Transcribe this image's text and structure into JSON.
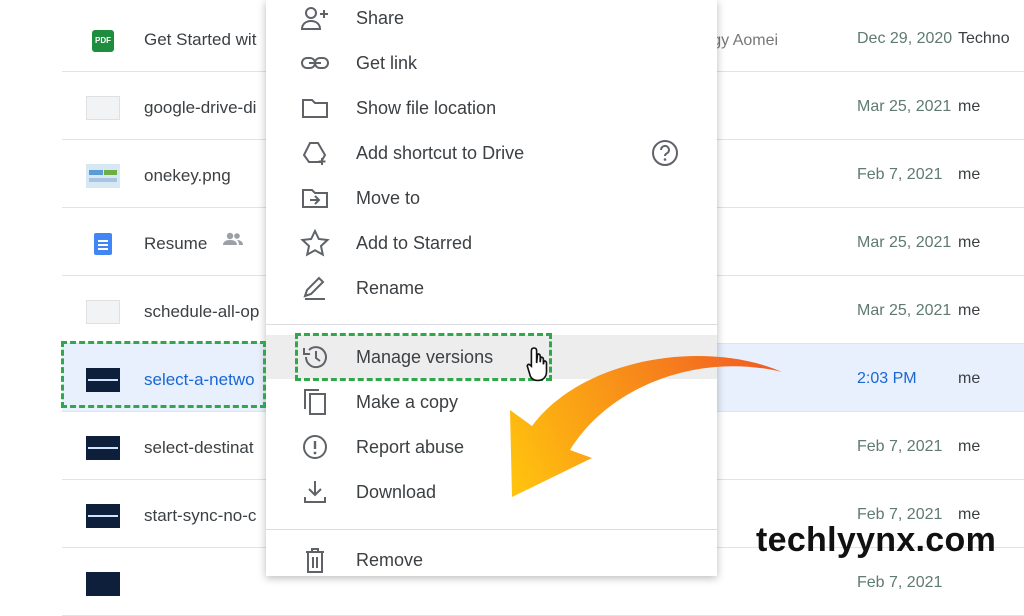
{
  "files": [
    {
      "name": "Get Started wit",
      "owner": "nology Aomei",
      "date": "Dec 29, 2020",
      "by": "Techno",
      "icon": "pdf-icon"
    },
    {
      "name": "google-drive-di",
      "owner": "",
      "date": "Mar 25, 2021",
      "by": "me",
      "icon": "image-thumbnail"
    },
    {
      "name": "onekey.png",
      "owner": "",
      "date": "Feb 7, 2021",
      "by": "me",
      "icon": "image-thumbnail"
    },
    {
      "name": "Resume",
      "owner": "",
      "date": "Mar 25, 2021",
      "by": "me",
      "icon": "google-doc-icon"
    },
    {
      "name": "schedule-all-op",
      "owner": "",
      "date": "Mar 25, 2021",
      "by": "me",
      "icon": "image-thumbnail"
    },
    {
      "name": "select-a-netwo",
      "owner": "",
      "date": "2:03 PM",
      "by": "me",
      "icon": "image-thumbnail"
    },
    {
      "name": "select-destinat",
      "owner": "",
      "date": "Feb 7, 2021",
      "by": "me",
      "icon": "image-thumbnail"
    },
    {
      "name": "start-sync-no-c",
      "owner": "",
      "date": "Feb 7, 2021",
      "by": "me",
      "icon": "image-thumbnail"
    },
    {
      "name": "",
      "owner": "",
      "date": "Feb 7, 2021",
      "by": "",
      "icon": "image-thumbnail"
    }
  ],
  "menu": {
    "share": "Share",
    "get_link": "Get link",
    "show_file_location": "Show file location",
    "add_shortcut": "Add shortcut to Drive",
    "move_to": "Move to",
    "add_to_starred": "Add to Starred",
    "rename": "Rename",
    "manage_versions": "Manage versions",
    "make_a_copy": "Make a copy",
    "report_abuse": "Report abuse",
    "download": "Download",
    "remove": "Remove"
  },
  "watermark": "techlyynx.com",
  "colors": {
    "highlight_dash": "#2ea84a",
    "arrow_start": "#f58220",
    "arrow_end": "#ffc107",
    "selected_row": "#e8f0fe",
    "selected_text": "#1967d2"
  }
}
